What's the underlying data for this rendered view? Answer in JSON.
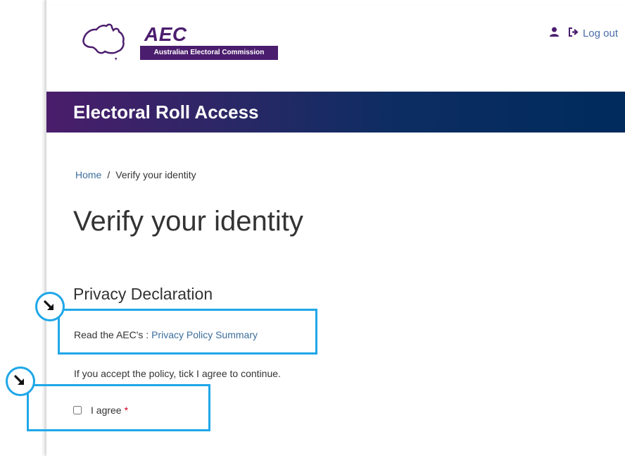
{
  "header": {
    "logo_title": "AEC",
    "logo_subtitle": "Australian Electoral Commission",
    "logout_label": "Log out",
    "icons": {
      "user": "user-icon",
      "logout": "sign-out-icon"
    }
  },
  "banner": {
    "title": "Electoral Roll Access"
  },
  "breadcrumb": {
    "home": "Home",
    "separator": "/",
    "current": "Verify your identity"
  },
  "main": {
    "title": "Verify your identity",
    "section_title": "Privacy Declaration",
    "read_prefix": "Read the AEC's : ",
    "policy_link": "Privacy Policy Summary",
    "accept_text": "If you accept the policy, tick I agree to continue.",
    "agree_label": "I agree",
    "required_mark": "*"
  },
  "annotations": {
    "pointer_icon": "arrow-down-right-icon",
    "highlight_color": "#1fa7e8"
  },
  "colors": {
    "brand_purple": "#4b1d6e",
    "banner_navy": "#002b5c",
    "link": "#3c6f9c",
    "required": "#d6001c"
  }
}
